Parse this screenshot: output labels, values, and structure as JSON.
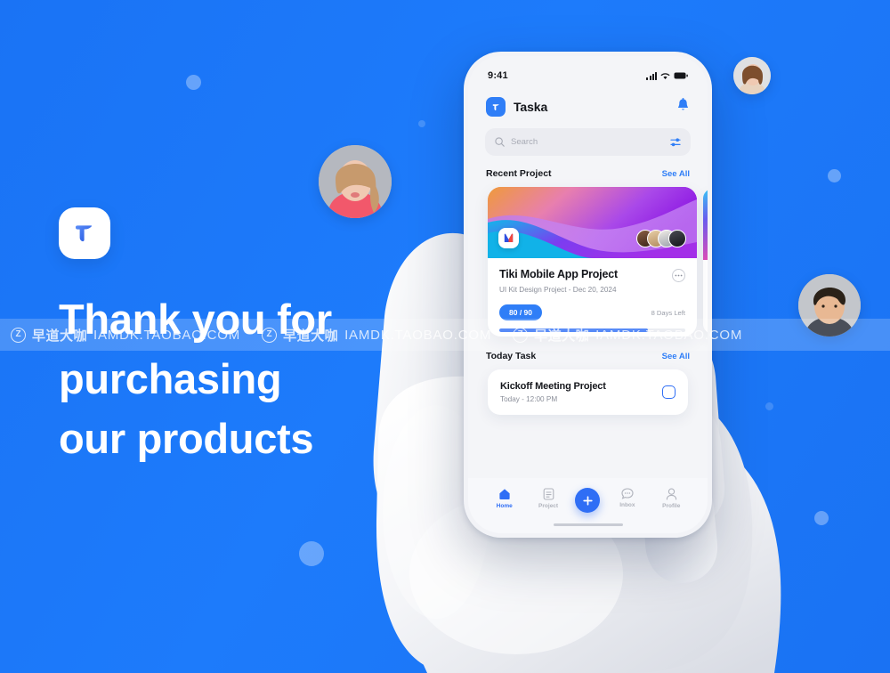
{
  "background": {
    "color": "#1a73f5",
    "accent": "#2f7ef7"
  },
  "brand": {
    "logo_icon": "taska-t-logo-icon",
    "headline_line1": "Thank you for",
    "headline_line2": "purchasing",
    "headline_line3": "our products"
  },
  "watermark": {
    "z_letter": "Z",
    "chinese": "早道大咖",
    "url": "IAMDK.TAOBAO.COM"
  },
  "avatars": [
    {
      "name": "avatar-bubble-woman-left"
    },
    {
      "name": "avatar-bubble-woman-top-right"
    },
    {
      "name": "avatar-bubble-man-right"
    }
  ],
  "phone": {
    "status_bar": {
      "time": "9:41",
      "signal_icon": "cellular-signal-icon",
      "wifi_icon": "wifi-icon",
      "battery_icon": "battery-full-icon"
    },
    "header": {
      "app_logo_icon": "taska-app-logo-icon",
      "app_title": "Taska",
      "notification_icon": "bell-icon"
    },
    "search": {
      "placeholder": "Search",
      "search_icon": "search-icon",
      "filter_icon": "filter-sliders-icon"
    },
    "recent_section": {
      "title": "Recent Project",
      "see_all": "See All"
    },
    "project_card": {
      "brand_icon": "m-logo-icon",
      "title": "Tiki Mobile App Project",
      "subtitle": "UI Kit Design Project - Dec 20, 2024",
      "more_icon": "more-options-icon",
      "count_badge": "80 / 90",
      "days_left": "8 Days Left",
      "progress_percent": 80,
      "member_count": 4
    },
    "today_section": {
      "title": "Today Task",
      "see_all": "See All"
    },
    "task_card": {
      "title": "Kickoff Meeting Project",
      "subtitle": "Today - 12:00 PM",
      "checkbox_icon": "checkbox-unchecked-icon"
    },
    "tabbar": {
      "items": [
        {
          "label": "Home",
          "icon": "home-icon",
          "active": true
        },
        {
          "label": "Project",
          "icon": "document-icon",
          "active": false
        },
        {
          "label": "Inbox",
          "icon": "chat-bubble-icon",
          "active": false
        },
        {
          "label": "Profile",
          "icon": "person-icon",
          "active": false
        }
      ],
      "add_button_icon": "plus-icon"
    }
  }
}
